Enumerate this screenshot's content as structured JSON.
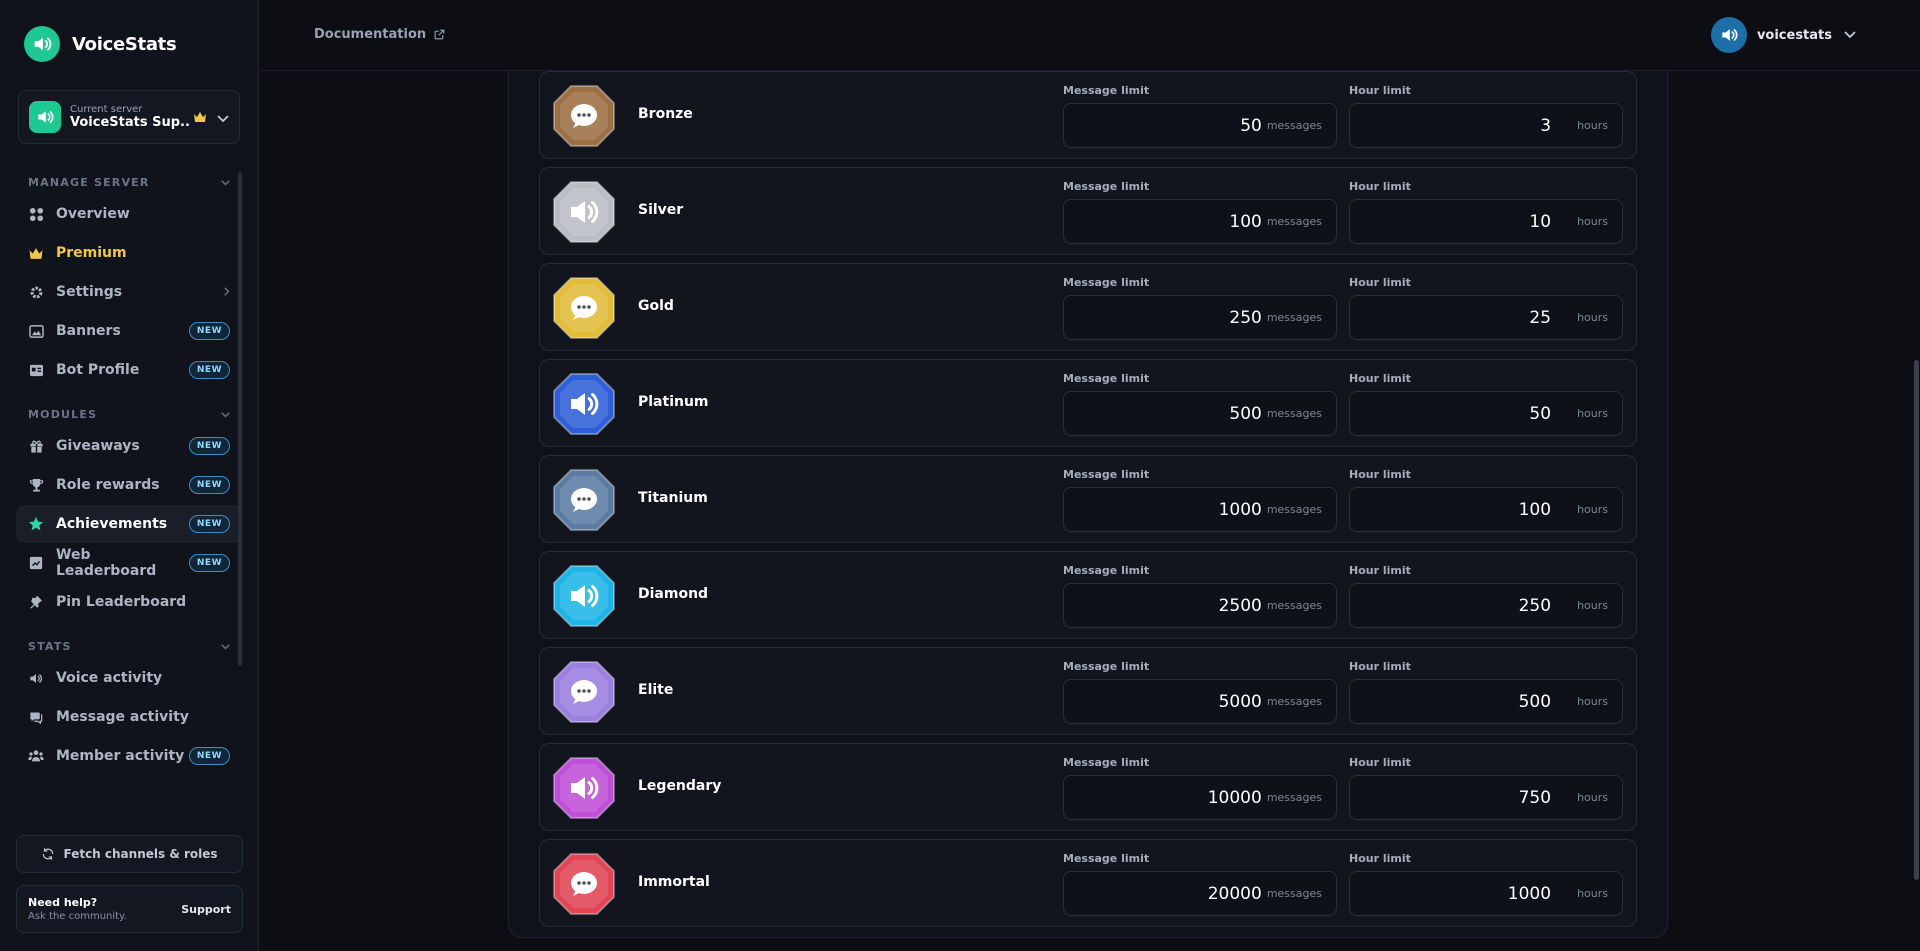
{
  "brand": {
    "name": "VoiceStats"
  },
  "server": {
    "caption": "Current server",
    "name": "VoiceStats Sup..."
  },
  "nav": {
    "sections": [
      {
        "title": "MANAGE SERVER",
        "items": [
          {
            "label": "Overview",
            "icon": "grid-icon"
          },
          {
            "label": "Premium",
            "icon": "crown-icon"
          },
          {
            "label": "Settings",
            "icon": "gear-icon"
          },
          {
            "label": "Banners",
            "icon": "image-icon",
            "badge": "NEW"
          },
          {
            "label": "Bot Profile",
            "icon": "id-card-icon",
            "badge": "NEW"
          }
        ]
      },
      {
        "title": "MODULES",
        "items": [
          {
            "label": "Giveaways",
            "icon": "gift-icon",
            "badge": "NEW"
          },
          {
            "label": "Role rewards",
            "icon": "trophy-icon",
            "badge": "NEW"
          },
          {
            "label": "Achievements",
            "icon": "star-icon",
            "badge": "NEW",
            "active": true
          },
          {
            "label": "Web Leaderboard",
            "icon": "chart-icon",
            "badge": "NEW"
          },
          {
            "label": "Pin Leaderboard",
            "icon": "pin-icon"
          }
        ]
      },
      {
        "title": "STATS",
        "items": [
          {
            "label": "Voice activity",
            "icon": "speaker-icon"
          },
          {
            "label": "Message activity",
            "icon": "chat-icon"
          },
          {
            "label": "Member activity",
            "icon": "users-icon",
            "badge": "NEW"
          }
        ]
      }
    ]
  },
  "fetch_button": "Fetch channels & roles",
  "help": {
    "title": "Need help?",
    "subtitle": "Ask the community.",
    "link": "Support"
  },
  "topbar": {
    "docs_label": "Documentation",
    "username": "voicestats"
  },
  "tiers": {
    "message_label": "Message limit",
    "hour_label": "Hour limit",
    "messages_unit": "messages",
    "hours_unit": "hours",
    "items": [
      {
        "name": "Bronze",
        "messages": "50",
        "hours": "3",
        "color": "#9c7045",
        "icon": "chat-icon"
      },
      {
        "name": "Silver",
        "messages": "100",
        "hours": "10",
        "color": "#b9bcc4",
        "icon": "speaker-icon"
      },
      {
        "name": "Gold",
        "messages": "250",
        "hours": "25",
        "color": "#e2bb39",
        "icon": "chat-icon"
      },
      {
        "name": "Platinum",
        "messages": "500",
        "hours": "50",
        "color": "#2e5fd6",
        "icon": "speaker-icon"
      },
      {
        "name": "Titanium",
        "messages": "1000",
        "hours": "100",
        "color": "#5c7ba3",
        "icon": "chat-icon"
      },
      {
        "name": "Diamond",
        "messages": "2500",
        "hours": "250",
        "color": "#1eb4e6",
        "icon": "speaker-icon"
      },
      {
        "name": "Elite",
        "messages": "5000",
        "hours": "500",
        "color": "#9a7ee0",
        "icon": "chat-icon"
      },
      {
        "name": "Legendary",
        "messages": "10000",
        "hours": "750",
        "color": "#c04fd8",
        "icon": "speaker-icon"
      },
      {
        "name": "Immortal",
        "messages": "20000",
        "hours": "1000",
        "color": "#e04455",
        "icon": "chat-icon"
      }
    ]
  }
}
